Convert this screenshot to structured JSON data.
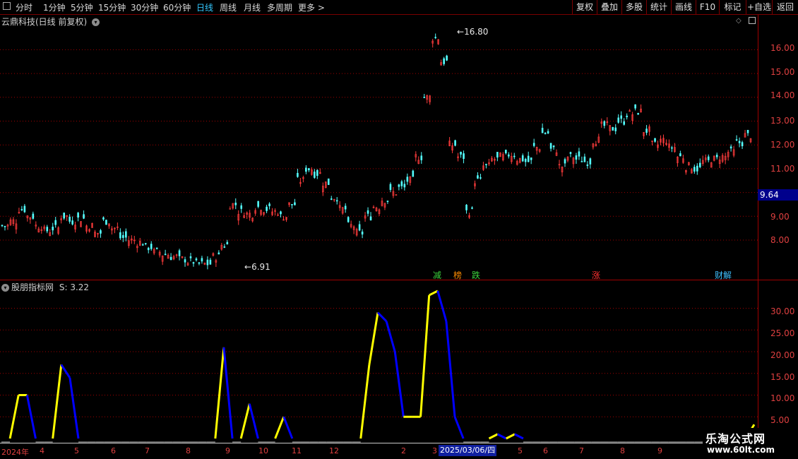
{
  "toolbar": {
    "tabs": [
      "分时",
      "1分钟",
      "5分钟",
      "15分钟",
      "30分钟",
      "60分钟",
      "日线",
      "周线",
      "月线",
      "多周期",
      "更多 >"
    ],
    "active_tab": "日线",
    "right_buttons": [
      "复权",
      "叠加",
      "多股",
      "统计",
      "画线",
      "F10",
      "标记",
      "+自选",
      "返回"
    ]
  },
  "main_panel": {
    "title": "云鼎科技(日线 前复权)",
    "y_ticks": [
      "16.00",
      "15.00",
      "14.00",
      "13.00",
      "12.00",
      "11.00",
      "10.00",
      "9.00",
      "8.00"
    ],
    "current_price": "9.64",
    "high_marker": "16.80",
    "low_marker": "6.91",
    "event_tags": [
      {
        "label": "减",
        "color": "#3cd23c"
      },
      {
        "label": "榜",
        "color": "#ff8c00"
      },
      {
        "label": "跌",
        "color": "#3cd23c"
      },
      {
        "label": "涨",
        "color": "#ff3030"
      },
      {
        "label": "财解",
        "color": "#40c0ff"
      }
    ]
  },
  "sub_panel": {
    "title": "股朋指标网",
    "value_label": "S: 3.22",
    "y_ticks": [
      "30.00",
      "25.00",
      "20.00",
      "15.00",
      "10.00",
      "5.00"
    ]
  },
  "x_axis": {
    "labels": [
      "2024年",
      "4",
      "5",
      "6",
      "7",
      "8",
      "9",
      "10",
      "11",
      "12",
      "2",
      "3",
      "4",
      "5",
      "6",
      "7",
      "8",
      "9"
    ],
    "cursor_date": "2025/03/06/四"
  },
  "watermark": {
    "line1": "乐淘公式网",
    "line2": "www.60lt.com"
  },
  "colors": {
    "grid": "#a00000",
    "up": "#ff3c3c",
    "down": "#54ffff",
    "indicator_rise": "#ffff00",
    "indicator_fall": "#0000ff",
    "axis_text": "#e04040"
  },
  "chart_data": {
    "type": "line",
    "series": [
      {
        "name": "收盘价",
        "values": [
          8.6,
          8.8,
          9.3,
          9.0,
          8.6,
          8.4,
          8.5,
          9.0,
          8.8,
          8.9,
          8.6,
          8.3,
          8.8,
          8.5,
          8.1,
          8.0,
          7.9,
          7.7,
          7.5,
          7.4,
          7.3,
          7.2,
          7.1,
          7.0,
          7.0,
          7.3,
          7.8,
          9.5,
          9.2,
          9.1,
          9.4,
          9.3,
          9.2,
          9.0,
          9.5,
          10.5,
          11.0,
          10.8,
          10.4,
          9.8,
          9.3,
          8.6,
          8.3,
          9.0,
          9.4,
          9.7,
          10.0,
          10.2,
          10.5,
          11.5,
          14.0,
          16.5,
          15.5,
          12.0,
          11.5,
          9.2,
          10.5,
          11.1,
          11.4,
          11.5,
          11.6,
          11.4,
          11.3,
          11.9,
          12.5,
          11.8,
          11.1,
          11.5,
          11.4,
          11.3,
          12.2,
          12.8,
          12.7,
          13.0,
          13.3,
          13.4,
          12.6,
          12.0,
          12.2,
          11.9,
          11.5,
          11.1,
          11.0,
          11.3,
          11.4,
          11.5,
          11.7,
          12.1,
          12.4
        ]
      },
      {
        "name": "S",
        "values": [
          0,
          0,
          10,
          10,
          0,
          0,
          0,
          17,
          14,
          0,
          0,
          0,
          0,
          0,
          0,
          0,
          0,
          0,
          0,
          0,
          0,
          0,
          0,
          0,
          0,
          0,
          21,
          0,
          0,
          8,
          0,
          0,
          0,
          5,
          0,
          0,
          0,
          0,
          0,
          0,
          0,
          0,
          0,
          17,
          29,
          27,
          20,
          5,
          5,
          5,
          33,
          34,
          27,
          5,
          0,
          0,
          0,
          0,
          1,
          0,
          1,
          0,
          0,
          0,
          0,
          0,
          0,
          0,
          0,
          0,
          0,
          0,
          0,
          0,
          0,
          0,
          0,
          0,
          0,
          0,
          0,
          0,
          0,
          0,
          0,
          0,
          0,
          0,
          3.22
        ]
      }
    ],
    "ylim_price": [
      6.91,
      16.8
    ],
    "ylim_indicator": [
      0,
      35
    ],
    "grid": true
  }
}
